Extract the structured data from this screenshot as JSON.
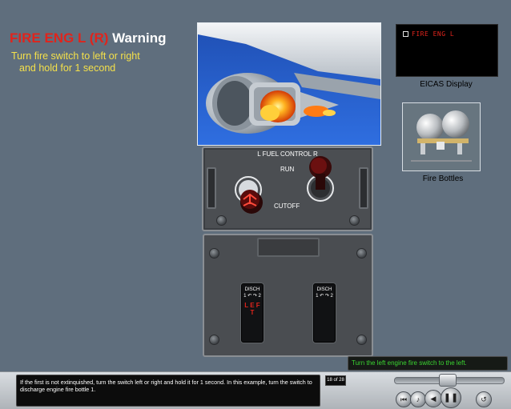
{
  "heading": {
    "red_part": "FIRE ENG L (R)",
    "white_part": " Warning"
  },
  "instructions": [
    "Turn fire switch to left or right",
    "and hold for 1 second"
  ],
  "eicas": {
    "message": "FIRE ENG L",
    "label": "EICAS Display"
  },
  "fire_bottles": {
    "label": "Fire Bottles"
  },
  "fuel_control": {
    "title": "L    FUEL CONTROL    R",
    "run_label": "RUN",
    "cutoff_label": "CUTOFF"
  },
  "fire_switches": {
    "left": {
      "disch": "DISCH",
      "arc": "1 ↶ ↷ 2",
      "text": "L E F T"
    },
    "right": {
      "disch": "DISCH",
      "arc": "1 ↶ ↷ 2"
    }
  },
  "status": "Turn the left engine fire switch to the left.",
  "caption": "If the first is not extinquished, turn the switch left or right and hold it for 1 second. In this example, turn the switch to discharge engine fire bottle 1.",
  "page_indicator": "18 of 28",
  "colors": {
    "background": "#5f6e7d",
    "warning_red": "#e0241c",
    "instruction_yellow": "#f4e04a",
    "status_green": "#3ad431"
  },
  "icons": {
    "back": "skip-back-icon",
    "audio": "audio-icon",
    "prev": "previous-icon",
    "pause": "pause-icon",
    "replay": "replay-icon"
  }
}
